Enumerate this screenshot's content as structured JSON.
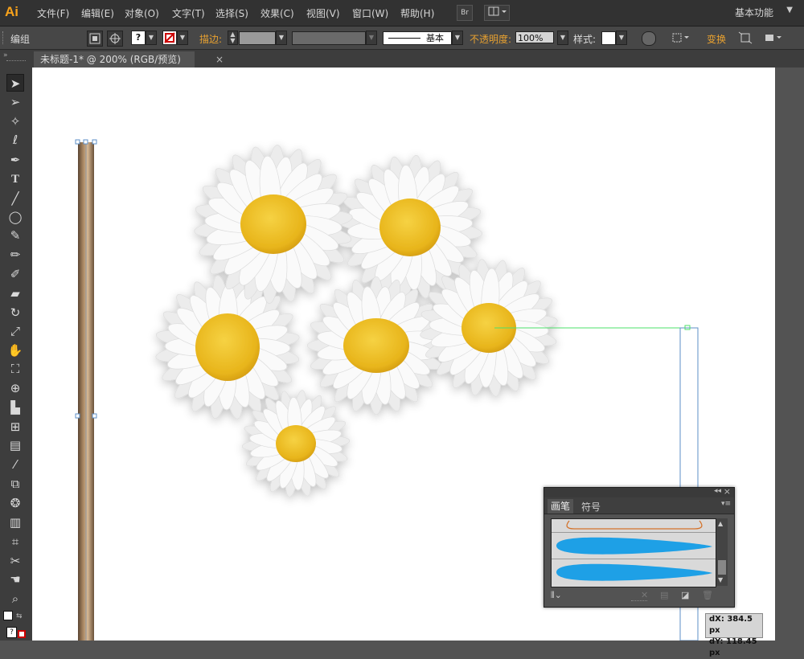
{
  "app": {
    "logo": "Ai",
    "workspace": "基本功能"
  },
  "menu": [
    "文件(F)",
    "编辑(E)",
    "对象(O)",
    "文字(T)",
    "选择(S)",
    "效果(C)",
    "视图(V)",
    "窗口(W)",
    "帮助(H)"
  ],
  "menubar_buttons": {
    "bridge": "Br"
  },
  "control": {
    "selection_label": "编组",
    "stroke_label": "描边:",
    "stroke_style": "基本",
    "opacity_label": "不透明度:",
    "opacity_value": "100%",
    "style_label": "样式:",
    "transform_label": "变换"
  },
  "document": {
    "tab_title": "未标题-1* @ 200% (RGB/预览)",
    "close": "×"
  },
  "panel": {
    "tabs": [
      "画笔",
      "符号"
    ]
  },
  "measure": {
    "dx": "dX: 384.5 px",
    "dy": "dY: 118.45 px"
  },
  "colors": {
    "accent": "#e8a130",
    "brush_blue": "#1ea0e6",
    "daisy_center": "#f2c320"
  }
}
